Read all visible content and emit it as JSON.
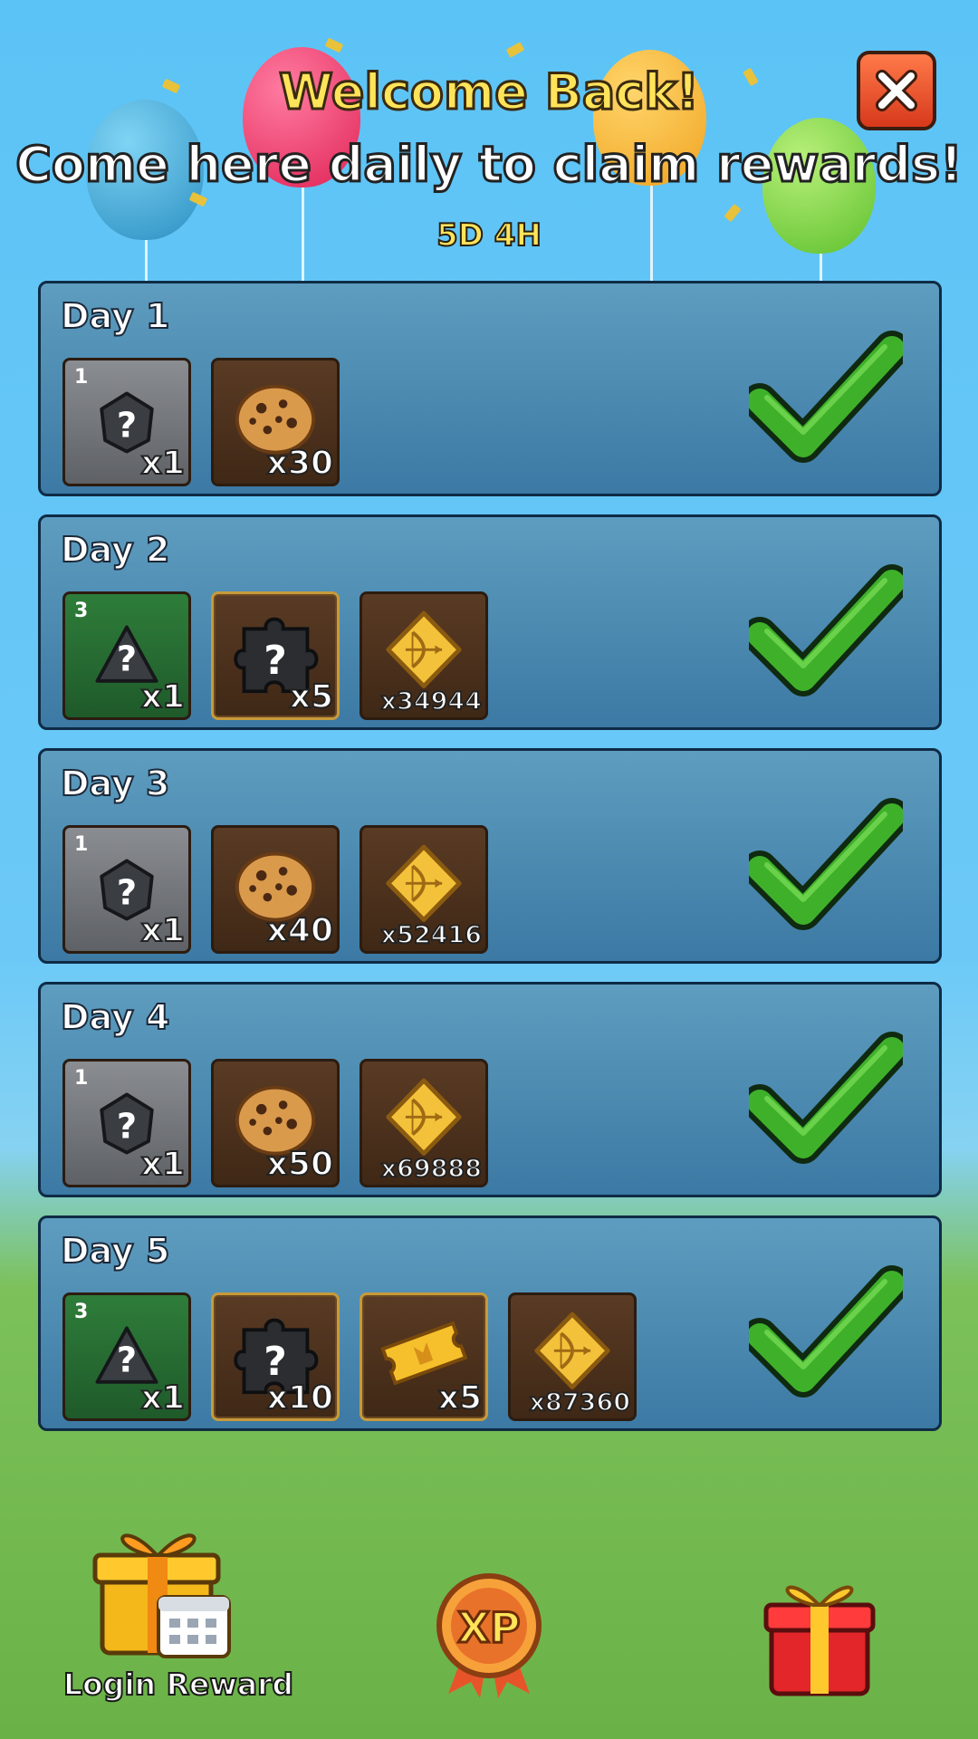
{
  "header": {
    "welcome": "Welcome Back!",
    "subtitle": "Come here daily to claim rewards!",
    "timer": "5D 4H"
  },
  "days": [
    {
      "label": "Day 1",
      "claimed": true,
      "rewards": [
        {
          "icon": "mystery-gem-icon",
          "tier": "1",
          "count": "x1"
        },
        {
          "icon": "cookie-icon",
          "count": "x30"
        }
      ]
    },
    {
      "label": "Day 2",
      "claimed": true,
      "rewards": [
        {
          "icon": "mystery-gem-icon",
          "tier": "3",
          "count": "x1"
        },
        {
          "icon": "mystery-puzzle-icon",
          "count": "x5"
        },
        {
          "icon": "bow-coin-icon",
          "count": "x34944"
        }
      ]
    },
    {
      "label": "Day 3",
      "claimed": true,
      "rewards": [
        {
          "icon": "mystery-gem-icon",
          "tier": "1",
          "count": "x1"
        },
        {
          "icon": "cookie-icon",
          "count": "x40"
        },
        {
          "icon": "bow-coin-icon",
          "count": "x52416"
        }
      ]
    },
    {
      "label": "Day 4",
      "claimed": true,
      "rewards": [
        {
          "icon": "mystery-gem-icon",
          "tier": "1",
          "count": "x1"
        },
        {
          "icon": "cookie-icon",
          "count": "x50"
        },
        {
          "icon": "bow-coin-icon",
          "count": "x69888"
        }
      ]
    },
    {
      "label": "Day 5",
      "claimed": true,
      "rewards": [
        {
          "icon": "mystery-gem-icon",
          "tier": "3",
          "count": "x1"
        },
        {
          "icon": "mystery-puzzle-icon",
          "count": "x10"
        },
        {
          "icon": "ticket-icon",
          "count": "x5"
        },
        {
          "icon": "bow-coin-icon",
          "count": "x87360"
        }
      ]
    }
  ],
  "bottom": {
    "login_reward_label": "Login Reward",
    "xp_badge": "XP"
  },
  "colors": {
    "check_green": "#3fb02a",
    "close_red": "#e84a24",
    "gold_text": "#ffe45a"
  }
}
